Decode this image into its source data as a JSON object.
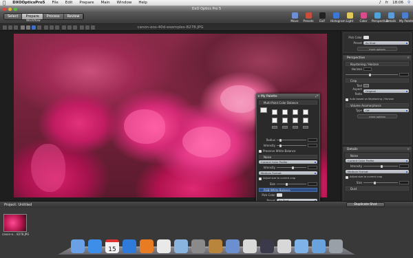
{
  "menubar": {
    "app_name": "DXOOpticsPro5",
    "items": [
      "File",
      "Edit",
      "Prepare",
      "Main",
      "Window",
      "Help"
    ],
    "flag": "fr",
    "clock": "18:06"
  },
  "window": {
    "title": "DxO Optics Pro 5"
  },
  "toolbar": {
    "tabs": [
      "Select",
      "Prepare",
      "Process",
      "Review"
    ],
    "active_tab": "Prepare",
    "workflow_label": "Workflow",
    "buttons": [
      {
        "label": "Move",
        "icon": "move-icon",
        "color": "#6c8fd6"
      },
      {
        "label": "Presets",
        "icon": "presets-icon",
        "color": "#c94d3b"
      },
      {
        "label": "Exif",
        "icon": "exif-icon",
        "color": "#222222"
      },
      {
        "label": "Histogram",
        "icon": "histogram-icon",
        "color": "#3a78d4"
      },
      {
        "label": "Light",
        "icon": "light-icon",
        "color": "#e0c85a"
      },
      {
        "label": "Color",
        "icon": "color-icon",
        "color": "#d94b8a"
      },
      {
        "label": "Perspective",
        "icon": "perspective-icon",
        "color": "#4fa3d9"
      },
      {
        "label": "Details",
        "icon": "details-icon",
        "color": "#5a9bd8"
      },
      {
        "label": "My Palette",
        "icon": "my-palette-icon",
        "color": "#4a7fd0"
      }
    ]
  },
  "viewer": {
    "filename": "canon-eos-40d-exemples-8278.JPG"
  },
  "right_panel": {
    "pick_color_label": "Pick Color",
    "preset_label": "Preset",
    "preset_value": "As Shot",
    "more_options": "more options",
    "perspective": {
      "title": "Perspective",
      "keystoning": "Keystoning / Horizon",
      "horizon_label": "Horizon",
      "crop": "Crop",
      "tool_label": "Tool",
      "aspect_label": "Aspect Ratio",
      "aspect_value": "Original",
      "auto_crop": "Auto based on Keystoning / Horizon",
      "volume": "Volume Anamorphosis",
      "type_label": "Type",
      "type_value": "Off"
    },
    "details": {
      "title": "Details",
      "noise": "Noise",
      "profile_value": "Current Color Profile",
      "intensity_label": "Intensity",
      "medium_format": "Medium Format",
      "adjust_crop": "Adjust size to current crop",
      "size_label": "Size",
      "dust": "Dust"
    }
  },
  "palette": {
    "title": "My Palette",
    "multipoint": "Multi-Point Color Balance",
    "radius_label": "Radius",
    "intensity_label": "Intensity",
    "preserve_wb": "Preserve White Balance",
    "noise": "Noise",
    "profile_value": "Current Color Profile",
    "intensity2": "Intensity",
    "medium_format": "Medium Format",
    "adjust_crop": "Adjust size to current crop",
    "size_label": "Size",
    "rgb_wb": "RGB White Balance",
    "pick_color": "Pick Color",
    "preset_label": "Preset",
    "preset_value": "As Shot",
    "more_options": "more options"
  },
  "project": {
    "label": "Project: Untitled",
    "duplicate": "Duplicate Shot",
    "thumb_label": "canon-e... 8278.JPG"
  },
  "dock": {
    "icons": [
      {
        "name": "finder-icon",
        "color": "#6aa0e6"
      },
      {
        "name": "itunes-icon",
        "color": "#3d8ee8"
      },
      {
        "name": "ical-icon",
        "color": "#f2f2f2",
        "text": "15"
      },
      {
        "name": "quicktime-icon",
        "color": "#2f7bd9"
      },
      {
        "name": "firefox-icon",
        "color": "#e87c22"
      },
      {
        "name": "textedit-icon",
        "color": "#e9e9e9"
      },
      {
        "name": "mail-icon",
        "color": "#8ab4e0"
      },
      {
        "name": "preview-icon",
        "color": "#8a8a8a"
      },
      {
        "name": "addressbook-icon",
        "color": "#b9853c"
      },
      {
        "name": "network-icon",
        "color": "#6c8fd0"
      },
      {
        "name": "safari-icon",
        "color": "#d9d9d9"
      },
      {
        "name": "dxo-icon",
        "color": "#3a3a4a"
      },
      {
        "name": "document-icon",
        "color": "#d8d8d8"
      },
      {
        "name": "folder-icon",
        "color": "#7fb2e8"
      },
      {
        "name": "downloads-folder-icon",
        "color": "#6aa2de"
      },
      {
        "name": "trash-icon",
        "color": "#9aa0a8"
      }
    ]
  }
}
